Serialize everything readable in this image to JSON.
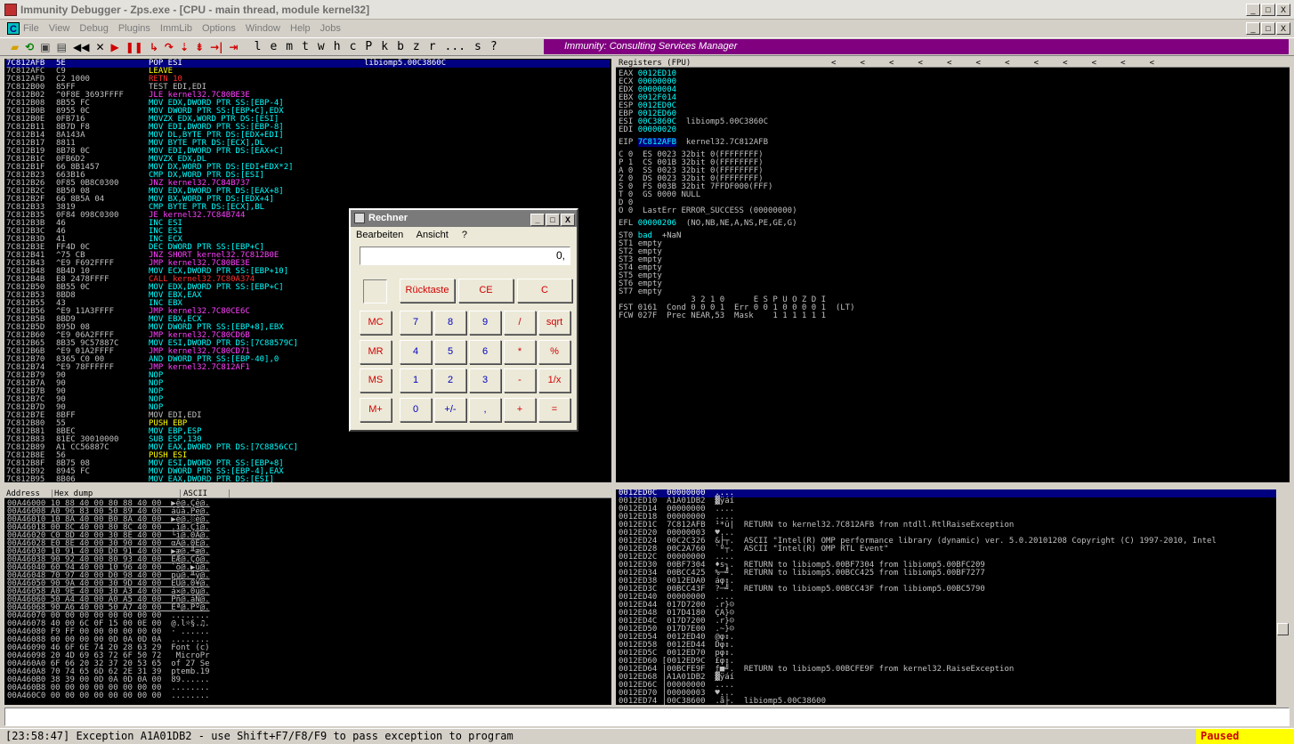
{
  "window": {
    "title": "Immunity Debugger - Zps.exe - [CPU - main thread, module kernel32]",
    "min": "_",
    "max": "□",
    "close": "X"
  },
  "menu": {
    "icon": "C",
    "items": [
      "File",
      "View",
      "Debug",
      "Plugins",
      "ImmLib",
      "Options",
      "Window",
      "Help",
      "Jobs"
    ]
  },
  "toolbar": {
    "letters": [
      "l",
      "e",
      "m",
      "t",
      "w",
      "h",
      "c",
      "P",
      "k",
      "b",
      "z",
      "r",
      "...",
      "s",
      "?"
    ],
    "banner": "Immunity: Consulting Services Manager"
  },
  "disasm": [
    {
      "a": "7C812AFB",
      "h": "5E",
      "i": "POP ESI",
      "k": "y",
      "x": "libiomp5.00C3860C",
      "sel": true
    },
    {
      "a": "7C812AFC",
      "h": "C9",
      "i": "LEAVE",
      "k": "y"
    },
    {
      "a": "7C812AFD",
      "h": "C2 1000",
      "i": "RETN 10",
      "k": "r"
    },
    {
      "a": "7C812B00",
      "h": "85FF",
      "i": "TEST EDI,EDI",
      "k": "w"
    },
    {
      "a": "7C812B02",
      "h": "^0F8E 3693FFFF",
      "i": "JLE kernel32.7C80BE3E",
      "k": "m"
    },
    {
      "a": "7C812B08",
      "h": "8B55 FC",
      "i": "MOV EDX,DWORD PTR SS:[EBP-4]",
      "k": "c"
    },
    {
      "a": "7C812B0B",
      "h": "8955 0C",
      "i": "MOV DWORD PTR SS:[EBP+C],EDX",
      "k": "c"
    },
    {
      "a": "7C812B0E",
      "h": "0FB716",
      "i": "MOVZX EDX,WORD PTR DS:[ESI]",
      "k": "c"
    },
    {
      "a": "7C812B11",
      "h": "8B7D F8",
      "i": "MOV EDI,DWORD PTR SS:[EBP-8]",
      "k": "c"
    },
    {
      "a": "7C812B14",
      "h": "8A143A",
      "i": "MOV DL,BYTE PTR DS:[EDX+EDI]",
      "k": "c"
    },
    {
      "a": "7C812B17",
      "h": "8811",
      "i": "MOV BYTE PTR DS:[ECX],DL",
      "k": "c"
    },
    {
      "a": "7C812B19",
      "h": "8B78 0C",
      "i": "MOV EDI,DWORD PTR DS:[EAX+C]",
      "k": "c"
    },
    {
      "a": "7C812B1C",
      "h": "0FB6D2",
      "i": "MOVZX EDX,DL",
      "k": "c"
    },
    {
      "a": "7C812B1F",
      "h": "66 8B1457",
      "i": "MOV DX,WORD PTR DS:[EDI+EDX*2]",
      "k": "c"
    },
    {
      "a": "7C812B23",
      "h": "663B16",
      "i": "CMP DX,WORD PTR DS:[ESI]",
      "k": "c"
    },
    {
      "a": "7C812B26",
      "h": "0F85 0B8C0300",
      "i": "JNZ kernel32.7C84B737",
      "k": "m"
    },
    {
      "a": "7C812B2C",
      "h": "8B50 08",
      "i": "MOV EDX,DWORD PTR DS:[EAX+8]",
      "k": "c"
    },
    {
      "a": "7C812B2F",
      "h": "66 8B5A 04",
      "i": "MOV BX,WORD PTR DS:[EDX+4]",
      "k": "c"
    },
    {
      "a": "7C812B33",
      "h": "3819",
      "i": "CMP BYTE PTR DS:[ECX],BL",
      "k": "c"
    },
    {
      "a": "7C812B35",
      "h": "0F84 098C0300",
      "i": "JE kernel32.7C84B744",
      "k": "m"
    },
    {
      "a": "7C812B3B",
      "h": "46",
      "i": "INC ESI",
      "k": "c"
    },
    {
      "a": "7C812B3C",
      "h": "46",
      "i": "INC ESI",
      "k": "c"
    },
    {
      "a": "7C812B3D",
      "h": "41",
      "i": "INC ECX",
      "k": "c"
    },
    {
      "a": "7C812B3E",
      "h": "FF4D 0C",
      "i": "DEC DWORD PTR SS:[EBP+C]",
      "k": "c"
    },
    {
      "a": "7C812B41",
      "h": "^75 CB",
      "i": "JNZ SHORT kernel32.7C812B0E",
      "k": "m"
    },
    {
      "a": "7C812B43",
      "h": "^E9 F692FFFF",
      "i": "JMP kernel32.7C80BE3E",
      "k": "m"
    },
    {
      "a": "7C812B48",
      "h": "8B4D 10",
      "i": "MOV ECX,DWORD PTR SS:[EBP+10]",
      "k": "c"
    },
    {
      "a": "7C812B4B",
      "h": "E8 2478FFFF",
      "i": "CALL kernel32.7C80A374",
      "k": "r"
    },
    {
      "a": "7C812B50",
      "h": "8B55 0C",
      "i": "MOV EDX,DWORD PTR SS:[EBP+C]",
      "k": "c"
    },
    {
      "a": "7C812B53",
      "h": "8BD8",
      "i": "MOV EBX,EAX",
      "k": "c"
    },
    {
      "a": "7C812B55",
      "h": "43",
      "i": "INC EBX",
      "k": "c"
    },
    {
      "a": "7C812B56",
      "h": "^E9 11A3FFFF",
      "i": "JMP kernel32.7C80CE6C",
      "k": "m"
    },
    {
      "a": "7C812B5B",
      "h": "8BD9",
      "i": "MOV EBX,ECX",
      "k": "c"
    },
    {
      "a": "7C812B5D",
      "h": "895D 08",
      "i": "MOV DWORD PTR SS:[EBP+8],EBX",
      "k": "c"
    },
    {
      "a": "7C812B60",
      "h": "^E9 06A2FFFF",
      "i": "JMP kernel32.7C80CD6B",
      "k": "m"
    },
    {
      "a": "7C812B65",
      "h": "8B35 9C57887C",
      "i": "MOV ESI,DWORD PTR DS:[7C88579C]",
      "k": "c"
    },
    {
      "a": "7C812B6B",
      "h": "^E9 01A2FFFF",
      "i": "JMP kernel32.7C80CD71",
      "k": "m"
    },
    {
      "a": "7C812B70",
      "h": "8365 C0 00",
      "i": "AND DWORD PTR SS:[EBP-40],0",
      "k": "c"
    },
    {
      "a": "7C812B74",
      "h": "^E9 78FFFFFF",
      "i": "JMP kernel32.7C812AF1",
      "k": "m"
    },
    {
      "a": "7C812B79",
      "h": "90",
      "i": "NOP",
      "k": "c"
    },
    {
      "a": "7C812B7A",
      "h": "90",
      "i": "NOP",
      "k": "c"
    },
    {
      "a": "7C812B7B",
      "h": "90",
      "i": "NOP",
      "k": "c"
    },
    {
      "a": "7C812B7C",
      "h": "90",
      "i": "NOP",
      "k": "c"
    },
    {
      "a": "7C812B7D",
      "h": "90",
      "i": "NOP",
      "k": "c"
    },
    {
      "a": "7C812B7E",
      "h": "8BFF",
      "i": "MOV EDI,EDI",
      "k": "w"
    },
    {
      "a": "7C812B80",
      "h": "55",
      "i": "PUSH EBP",
      "k": "y"
    },
    {
      "a": "7C812B81",
      "h": "8BEC",
      "i": "MOV EBP,ESP",
      "k": "c"
    },
    {
      "a": "7C812B83",
      "h": "81EC 30010000",
      "i": "SUB ESP,130",
      "k": "c"
    },
    {
      "a": "7C812B89",
      "h": "A1 CC56887C",
      "i": "MOV EAX,DWORD PTR DS:[7C8856CC]",
      "k": "c"
    },
    {
      "a": "7C812B8E",
      "h": "56",
      "i": "PUSH ESI",
      "k": "y"
    },
    {
      "a": "7C812B8F",
      "h": "8B75 08",
      "i": "MOV ESI,DWORD PTR SS:[EBP+8]",
      "k": "c"
    },
    {
      "a": "7C812B92",
      "h": "8945 FC",
      "i": "MOV DWORD PTR SS:[EBP-4],EAX",
      "k": "c"
    },
    {
      "a": "7C812B95",
      "h": "8B06",
      "i": "MOV EAX,DWORD PTR DS:[ESI]",
      "k": "c"
    }
  ],
  "disasm_cut": "7C812B97 8985 00000000",
  "regs": {
    "header": "Registers (FPU)",
    "arrows": "<     <     <     <     <     <     <     <     <     <     <     <",
    "lines": [
      {
        "n": "EAX",
        "v": "0012ED10",
        "d": ""
      },
      {
        "n": "ECX",
        "v": "00000000",
        "d": ""
      },
      {
        "n": "EDX",
        "v": "00000004",
        "d": ""
      },
      {
        "n": "EBX",
        "v": "0012F014",
        "d": ""
      },
      {
        "n": "ESP",
        "v": "0012ED0C",
        "d": ""
      },
      {
        "n": "EBP",
        "v": "0012ED60",
        "d": ""
      },
      {
        "n": "ESI",
        "v": "00C3860C",
        "d": "libiomp5.00C3860C"
      },
      {
        "n": "EDI",
        "v": "00000020",
        "d": ""
      }
    ],
    "eip": {
      "n": "EIP",
      "v": "7C812AFB",
      "d": "kernel32.7C812AFB"
    },
    "flags": [
      "C 0  ES 0023 32bit 0(FFFFFFFF)",
      "P 1  CS 001B 32bit 0(FFFFFFFF)",
      "A 0  SS 0023 32bit 0(FFFFFFFF)",
      "Z 0  DS 0023 32bit 0(FFFFFFFF)",
      "S 0  FS 003B 32bit 7FFDF000(FFF)",
      "T 0  GS 0000 NULL",
      "D 0",
      "O 0  LastErr ERROR_SUCCESS (00000000)"
    ],
    "efl": {
      "n": "EFL",
      "v": "00000206",
      "d": "(NO,NB,NE,A,NS,PE,GE,G)"
    },
    "st": [
      {
        "n": "ST0",
        "v": "bad",
        "d": "+NaN"
      },
      {
        "n": "ST1",
        "v": "empty",
        "d": ""
      },
      {
        "n": "ST2",
        "v": "empty",
        "d": ""
      },
      {
        "n": "ST3",
        "v": "empty",
        "d": ""
      },
      {
        "n": "ST4",
        "v": "empty",
        "d": ""
      },
      {
        "n": "ST5",
        "v": "empty",
        "d": ""
      },
      {
        "n": "ST6",
        "v": "empty",
        "d": ""
      },
      {
        "n": "ST7",
        "v": "empty",
        "d": ""
      }
    ],
    "fhdr": "               3 2 1 0      E S P U O Z D I",
    "fst": "FST 0161  Cond 0 0 0 1  Err 0 0 1 0 0 0 0 1  (LT)",
    "fcw": "FCW 027F  Prec NEAR,53  Mask    1 1 1 1 1 1"
  },
  "dump": {
    "cols": [
      "Address",
      "Hex dump",
      "ASCII"
    ],
    "rows": [
      "00A46000 10 88 40 00 80 88 40 00  ▶ê@.Çê@.",
      "00A46008 A0 96 83 00 50 89 40 00  áûâ.Pë@.",
      "00A46010 10 8A 40 00 B0 8A 40 00  ▶è@.░è@.",
      "00A46018 00 8C 40 00 80 8C 40 00  .î@.Çî@.",
      "00A46020 C0 8D 40 00 30 8E 40 00  └ì@.0Ä@.",
      "00A46028 E0 8E 40 00 30 90 40 00  αÄ@.0É@.",
      "00A46030 10 91 40 00 D0 91 40 00  ▶æ@.╨æ@.",
      "00A46038 90 92 40 00 80 93 40 00  ÉÆ@.Çô@.",
      "00A46040 60 94 40 00 10 96 40 00  `ö@.▶û@.",
      "00A46048 70 97 40 00 D0 98 40 00  pù@.╨ÿ@.",
      "00A46050 90 9A 40 00 30 9D 40 00  ÉÜ@.0¥@.",
      "00A46058 A0 9E 40 00 30 A3 40 00  á×@.0ú@.",
      "00A46060 50 A4 40 00 A0 A5 40 00  Pñ@.áÑ@.",
      "00A46068 90 A6 40 00 50 A7 40 00  Éª@.Pº@.",
      "00A46070 00 00 00 00 00 00 00 00  ........",
      "00A46078 40 00 6C 0F 15 00 0E 00  @.l☼§.♫.",
      "00A46080 F9 FF 00 00 00 00 00 00  · ......",
      "00A46088 00 00 00 00 0D 0A 0D 0A  ........",
      "00A46090 46 6F 6E 74 20 28 63 29  Font (c)",
      "00A46098 20 4D 69 63 72 6F 50 72   MicroPr",
      "00A460A0 6F 66 20 32 37 20 53 65  of 27 Se",
      "00A460A8 70 74 65 6D 62 2E 31 39  ptemb.19",
      "00A460B0 38 39 00 0D 0A 0D 0A 00  89......",
      "00A460B8 00 00 00 00 00 00 00 00  ........",
      "00A460C0 00 00 00 00 00 00 00 00  ........"
    ]
  },
  "stack": [
    {
      "t": "0012ED0C  00000000  ....",
      "sel": true
    },
    {
      "t": "0012ED10  A1A01DB2  ▓ÿáí"
    },
    {
      "t": "0012ED14  00000000  ...."
    },
    {
      "t": "0012ED18  00000000  ...."
    },
    {
      "t": "0012ED1C  7C812AFB  ¹*ü|  RETURN to kernel32.7C812AFB from ntdll.RtlRaiseException"
    },
    {
      "t": "0012ED20  00000003  ♥..."
    },
    {
      "t": "0012ED24  00C2C326  &├┬.  ASCII \"Intel(R) OMP performance library (dynamic) ver. 5.0.20101208 Copyright (C) 1997-2010, Intel"
    },
    {
      "t": "0012ED28  00C2A760  `º┬.  ASCII \"Intel(R) OMP RTL Event\""
    },
    {
      "t": "0012ED2C  00000000  ...."
    },
    {
      "t": "0012ED30  00BF7304  ♦s┐.  RETURN to libiomp5.00BF7304 from libiomp5.00BFC209"
    },
    {
      "t": "0012ED34  00BCC425  %─╝.  RETURN to libiomp5.00BCC425 from libiomp5.00BF7277"
    },
    {
      "t": "0012ED38  0012EDA0  áφ↕."
    },
    {
      "t": "0012ED3C  00BCC43F  ?─╝.  RETURN to libiomp5.00BCC43F from libiomp5.00BC5790"
    },
    {
      "t": "0012ED40  00000000  ...."
    },
    {
      "t": "0012ED44  017D7200  .r}☺"
    },
    {
      "t": "0012ED48  017D4180  ÇA}☺"
    },
    {
      "t": "0012ED4C  017D7200  .r}☺"
    },
    {
      "t": "0012ED50  017D7E00  .~}☺"
    },
    {
      "t": "0012ED54  0012ED40  @φ↕."
    },
    {
      "t": "0012ED58  0012ED44  Dφ↕."
    },
    {
      "t": "0012ED5C  0012ED70  pφ↕."
    },
    {
      "t": "0012ED60 [0012ED9C  £φ↕."
    },
    {
      "t": "0012ED64 |00BCFE9F  ƒ■╝.  RETURN to libiomp5.00BCFE9F from kernel32.RaiseException"
    },
    {
      "t": "0012ED68 |A1A01DB2  ▓ÿáí"
    },
    {
      "t": "0012ED6C |00000000  ...."
    },
    {
      "t": "0012ED70 |00000003  ♥..."
    },
    {
      "t": "0012ED74 |00C38600  .å├.  libiomp5.00C38600"
    }
  ],
  "calc": {
    "title": "Rechner",
    "menu": [
      "Bearbeiten",
      "Ansicht",
      "?"
    ],
    "display": "0,",
    "row0": [
      "Rücktaste",
      "CE",
      "C"
    ],
    "mem": [
      "MC",
      "MR",
      "MS",
      "M+"
    ],
    "keys": [
      [
        "7",
        "8",
        "9",
        "/",
        "sqrt"
      ],
      [
        "4",
        "5",
        "6",
        "*",
        "%"
      ],
      [
        "1",
        "2",
        "3",
        "-",
        "1/x"
      ],
      [
        "0",
        "+/-",
        ",",
        "+",
        "="
      ]
    ]
  },
  "status": {
    "text": "[23:58:47] Exception A1A01DB2 - use Shift+F7/F8/F9 to pass exception to program",
    "state": "Paused"
  },
  "colors": {
    "selection": "#000080",
    "banner": "#800080",
    "paused_bg": "#ffff00",
    "paused_fg": "#d00000"
  }
}
